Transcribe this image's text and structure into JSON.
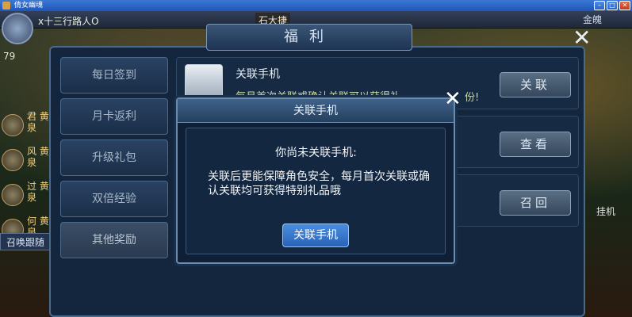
{
  "window": {
    "title": "倩女幽魂"
  },
  "hud": {
    "player_name": "x十三行路人O",
    "level": "79",
    "mid_name": "石大捷",
    "gold_label": "金魄",
    "left_list": [
      "君 黄泉",
      "风 黄泉",
      "过 黄泉",
      "何 黄泉"
    ],
    "summon": "召唤跟随",
    "auto": "挂机"
  },
  "welfare": {
    "title": "福利",
    "tabs": [
      "每日签到",
      "月卡返利",
      "升级礼包",
      "双倍经验",
      "其他奖励"
    ],
    "phone_row": {
      "title": "关联手机",
      "desc": "每月首次关联或确认关联可以获得礼",
      "desc_tail": "份!"
    },
    "buttons": {
      "link": "关联",
      "view": "查看",
      "recall": "召回"
    }
  },
  "dialog": {
    "title": "关联手机",
    "heading": "你尚未关联手机:",
    "body": "关联后更能保障角色安全，每月首次关联或确认关联均可获得特别礼品哦",
    "button": "关联手机"
  }
}
